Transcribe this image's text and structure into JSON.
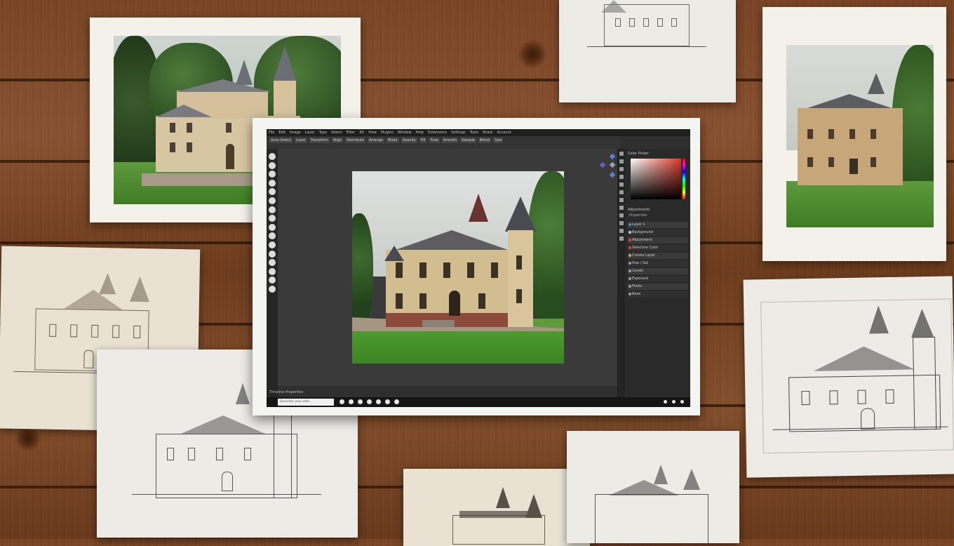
{
  "editor": {
    "menu": [
      "File",
      "Edit",
      "Image",
      "Layer",
      "Type",
      "Select",
      "Filter",
      "3D",
      "View",
      "Plugins",
      "Window",
      "Help",
      "Extensions",
      "Settings",
      "Tools",
      "Share",
      "Account"
    ],
    "options": [
      "Auto-Select",
      "Layer",
      "Transform",
      "Align",
      "Distribute",
      "Arrange",
      "Mode",
      "Opacity",
      "Fill",
      "Flow",
      "Smooth",
      "Sample",
      "Blend",
      "Size"
    ],
    "right_panel": {
      "title": "Color Picker",
      "section": "Adjustments",
      "sub": "Properties",
      "rows": [
        "Layer 1",
        "Background",
        "Adjustment",
        "Selective Color",
        "Curves Layer",
        "Hue / Sat",
        "Levels",
        "Exposure",
        "Photo",
        "Base"
      ]
    },
    "status": "Timeline  Properties",
    "bottom_input_placeholder": "Describe your edit..."
  },
  "colors": {
    "wood": "#7a4524",
    "editor_bg": "#2f2f2f",
    "panel_bg": "#2a2a2a",
    "accent_red": "#d93a2a"
  }
}
